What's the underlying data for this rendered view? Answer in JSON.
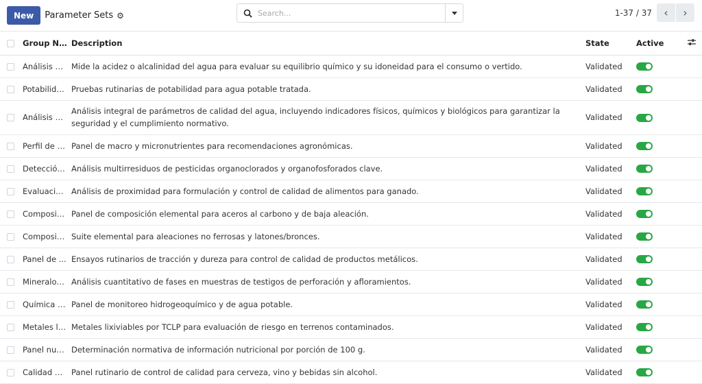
{
  "header": {
    "new_label": "New",
    "title": "Parameter Sets",
    "search_placeholder": "Search...",
    "pager": "1-37 / 37"
  },
  "columns": {
    "name": "Group Na...",
    "description": "Description",
    "state": "State",
    "active": "Active"
  },
  "rows": [
    {
      "name": "Análisis d...",
      "description": "Mide la acidez o alcalinidad del agua para evaluar su equilibrio químico y su idoneidad para el consumo o vertido.",
      "state": "Validated",
      "active": true
    },
    {
      "name": "Potabilida...",
      "description": "Pruebas rutinarias de potabilidad para agua potable tratada.",
      "state": "Validated",
      "active": true
    },
    {
      "name": "Análisis d...",
      "description": "Análisis integral de parámetros de calidad del agua, incluyendo indicadores físicos, químicos y biológicos para garantizar la seguridad y el cumplimiento normativo.",
      "state": "Validated",
      "active": true
    },
    {
      "name": "Perfil de n...",
      "description": "Panel de macro y micronutrientes para recomendaciones agronómicas.",
      "state": "Validated",
      "active": true
    },
    {
      "name": "Detección...",
      "description": "Análisis multirresiduos de pesticidas organoclorados y organofosforados clave.",
      "state": "Validated",
      "active": true
    },
    {
      "name": "Evaluació...",
      "description": "Análisis de proximidad para formulación y control de calidad de alimentos para ganado.",
      "state": "Validated",
      "active": true
    },
    {
      "name": "Composici...",
      "description": "Panel de composición elemental para aceros al carbono y de baja aleación.",
      "state": "Validated",
      "active": true
    },
    {
      "name": "Composici...",
      "description": "Suite elemental para aleaciones no ferrosas y latones/bronces.",
      "state": "Validated",
      "active": true
    },
    {
      "name": "Panel de ...",
      "description": "Ensayos rutinarios de tracción y dureza para control de calidad de productos metálicos.",
      "state": "Validated",
      "active": true
    },
    {
      "name": "Mineralog...",
      "description": "Análisis cuantitativo de fases en muestras de testigos de perforación y afloramientos.",
      "state": "Validated",
      "active": true
    },
    {
      "name": "Química d...",
      "description": "Panel de monitoreo hidrogeoquímico y de agua potable.",
      "state": "Validated",
      "active": true
    },
    {
      "name": "Metales li...",
      "description": "Metales lixiviables por TCLP para evaluación de riesgo en terrenos contaminados.",
      "state": "Validated",
      "active": true
    },
    {
      "name": "Panel nutr...",
      "description": "Determinación normativa de información nutricional por porción de 100 g.",
      "state": "Validated",
      "active": true
    },
    {
      "name": "Calidad d...",
      "description": "Panel rutinario de control de calidad para cerveza, vino y bebidas sin alcohol.",
      "state": "Validated",
      "active": true
    }
  ],
  "colors": {
    "primary": "#3b5ba7",
    "toggle_on": "#28a745"
  }
}
